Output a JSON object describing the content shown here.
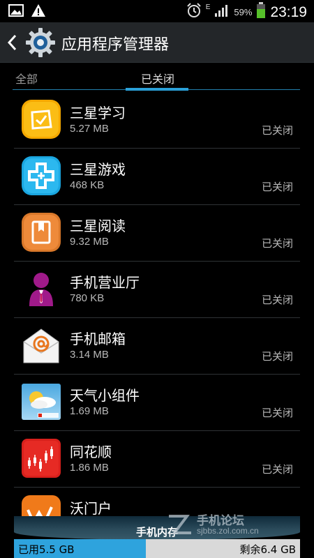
{
  "status_bar": {
    "network_indicator": "E",
    "battery_percent": "59%",
    "time": "23:19",
    "icons": [
      "gallery-icon",
      "warning-icon",
      "alarm-icon",
      "signal-icon",
      "battery-icon"
    ]
  },
  "action_bar": {
    "title": "应用程序管理器",
    "icons": [
      "back-arrow-icon",
      "settings-gear-icon"
    ]
  },
  "tabs": [
    {
      "label": "全部",
      "selected": false
    },
    {
      "label": "已关闭",
      "selected": true
    }
  ],
  "apps": [
    {
      "name": "三星学习",
      "size": "5.27 MB",
      "status": "已关闭",
      "icon": "samsung-learning-icon"
    },
    {
      "name": "三星游戏",
      "size": "468 KB",
      "status": "已关闭",
      "icon": "samsung-games-icon"
    },
    {
      "name": "三星阅读",
      "size": "9.32 MB",
      "status": "已关闭",
      "icon": "samsung-reader-icon"
    },
    {
      "name": "手机营业厅",
      "size": "780 KB",
      "status": "已关闭",
      "icon": "mobile-service-hall-icon"
    },
    {
      "name": "手机邮箱",
      "size": "3.14 MB",
      "status": "已关闭",
      "icon": "mail-icon"
    },
    {
      "name": "天气小组件",
      "size": "1.69 MB",
      "status": "已关闭",
      "icon": "weather-widget-icon"
    },
    {
      "name": "同花顺",
      "size": "1.86 MB",
      "status": "已关闭",
      "icon": "stock-chart-icon"
    },
    {
      "name": "沃门户",
      "size": "",
      "status": "",
      "icon": "wo-portal-icon"
    }
  ],
  "memory": {
    "title": "手机内存",
    "used_label": "已用5.5 GB",
    "free_label": "剩余6.4 GB",
    "used_fraction": 0.46
  },
  "watermark": {
    "line1": "手机论坛",
    "line2": "sjbbs.zol.com.cn"
  },
  "colors": {
    "accent": "#2aa0d8",
    "action_bar_bg": "#232629",
    "divider": "#2f3336"
  }
}
